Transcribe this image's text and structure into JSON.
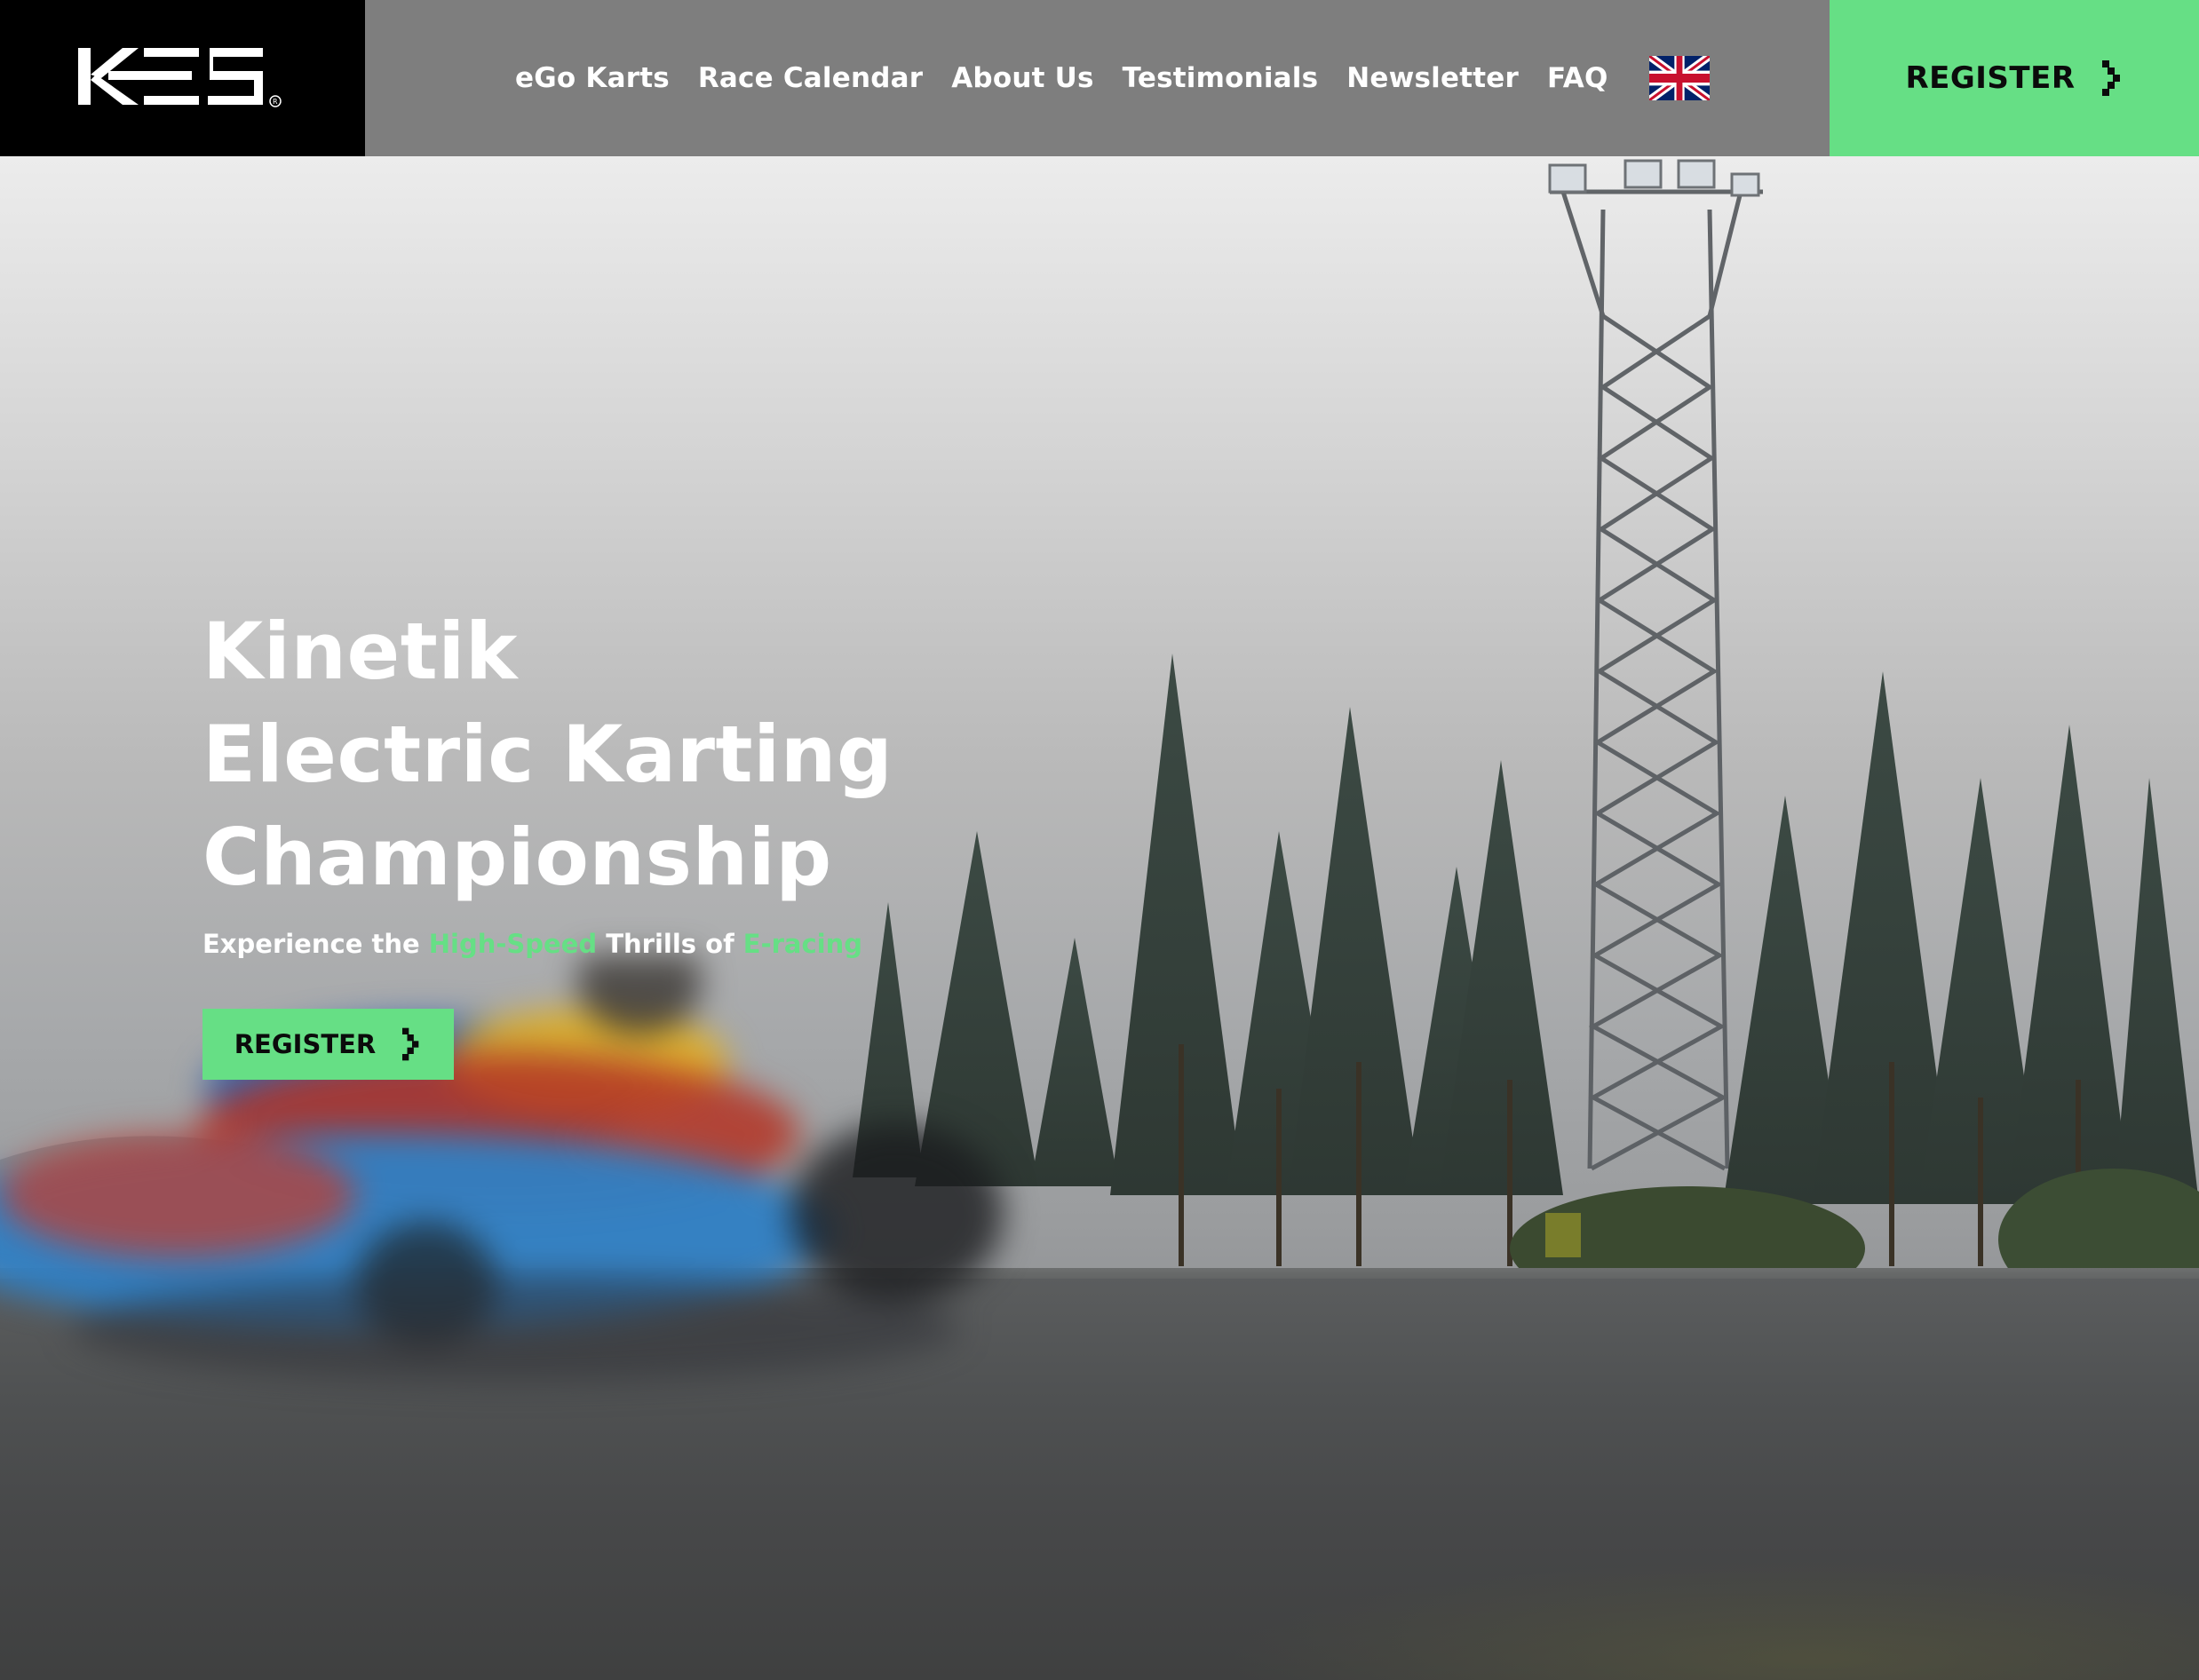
{
  "header": {
    "logo_text": "KES",
    "logo_mark": "®",
    "nav": [
      {
        "label": "eGo Karts"
      },
      {
        "label": "Race Calendar"
      },
      {
        "label": "About Us"
      },
      {
        "label": "Testimonials"
      },
      {
        "label": "Newsletter"
      },
      {
        "label": "FAQ"
      }
    ],
    "language_flag_icon": "uk-flag-icon",
    "register_label": "REGISTER",
    "register_icon": "chevron-right-icon"
  },
  "hero": {
    "title_lines": [
      "Kinetik",
      "Electric Karting",
      "Championship"
    ],
    "subtitle_parts": {
      "p1": "Experience the ",
      "highlight1": "High-Speed",
      "p2": " Thrills of ",
      "highlight2": "E-racing"
    },
    "register_label": "REGISTER",
    "register_icon": "chevron-right-icon"
  },
  "colors": {
    "accent": "#66df85",
    "header_bg": "#7e7e7e",
    "logo_bg": "#000000",
    "text_light": "#ffffff",
    "text_dark": "#0b0b0b"
  }
}
